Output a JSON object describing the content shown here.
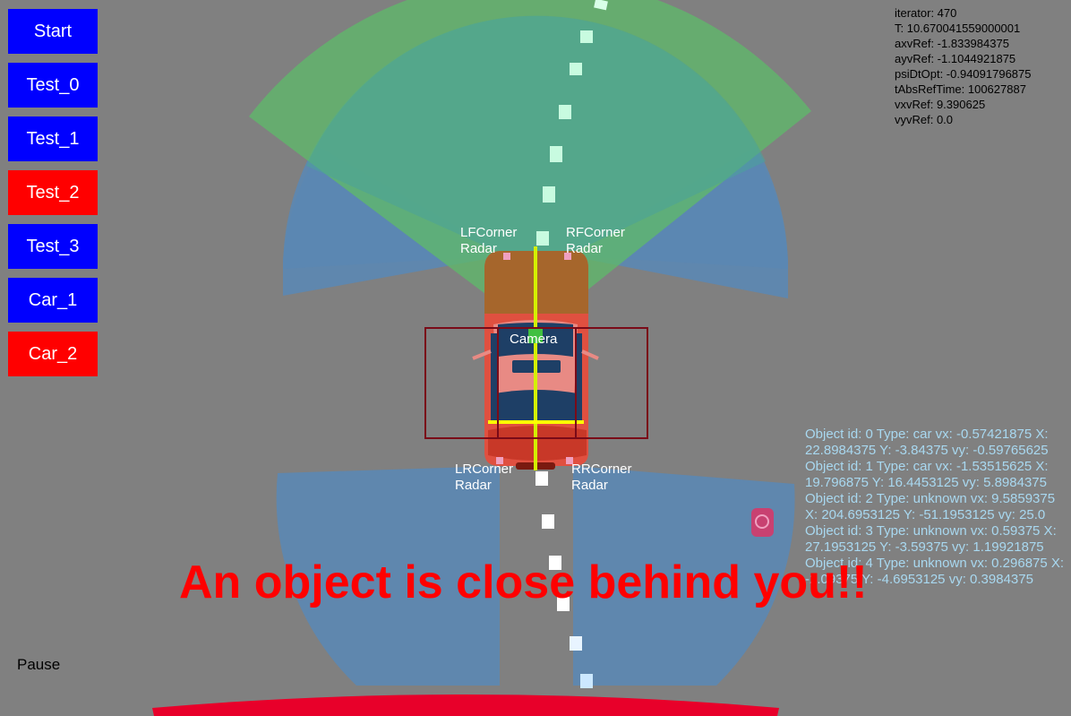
{
  "buttons": [
    {
      "label": "Start",
      "color": "#0000ff"
    },
    {
      "label": "Test_0",
      "color": "#0000ff"
    },
    {
      "label": "Test_1",
      "color": "#0000ff"
    },
    {
      "label": "Test_2",
      "color": "#ff0000"
    },
    {
      "label": "Test_3",
      "color": "#0000ff"
    },
    {
      "label": "Car_1",
      "color": "#0000ff"
    },
    {
      "label": "Car_2",
      "color": "#ff0000"
    }
  ],
  "pause_label": "Pause",
  "telemetry": [
    "iterator: 470",
    "T: 10.670041559000001",
    "axvRef: -1.833984375",
    "ayvRef: -1.1044921875",
    "psiDtOpt: -0.94091796875",
    "tAbsRefTime: 100627887",
    "vxvRef: 9.390625",
    "vyvRef: 0.0"
  ],
  "objects": [
    "Object id: 0 Type: car vx: -0.57421875 X: 22.8984375 Y: -3.84375 vy: -0.59765625",
    "Object id: 1 Type: car vx: -1.53515625 X: 19.796875 Y: 16.4453125 vy: 5.8984375",
    "Object id: 2 Type: unknown vx: 9.5859375 X: 204.6953125 Y: -51.1953125 vy: 25.0",
    "Object id: 3 Type: unknown vx: 0.59375 X: 27.1953125 Y: -3.59375 vy: 1.19921875",
    "Object id: 4 Type: unknown vx: 0.296875 X: -2.09375 Y: -4.6953125 vy: 0.3984375"
  ],
  "sensors": {
    "lf": "LFCorner\nRadar",
    "rf": "RFCorner\nRadar",
    "lr": "LRCorner\nRadar",
    "rr": "RRCorner\nRadar",
    "camera": "Camera"
  },
  "warning": "An object is close behind you!!",
  "colors": {
    "background": "#808080",
    "radar_blue": "#5b87b3",
    "camera_green": "#5fb86a",
    "warning_red": "#ff0000",
    "ego_car": "#e05040",
    "bounding_box": "#7a0a18"
  }
}
